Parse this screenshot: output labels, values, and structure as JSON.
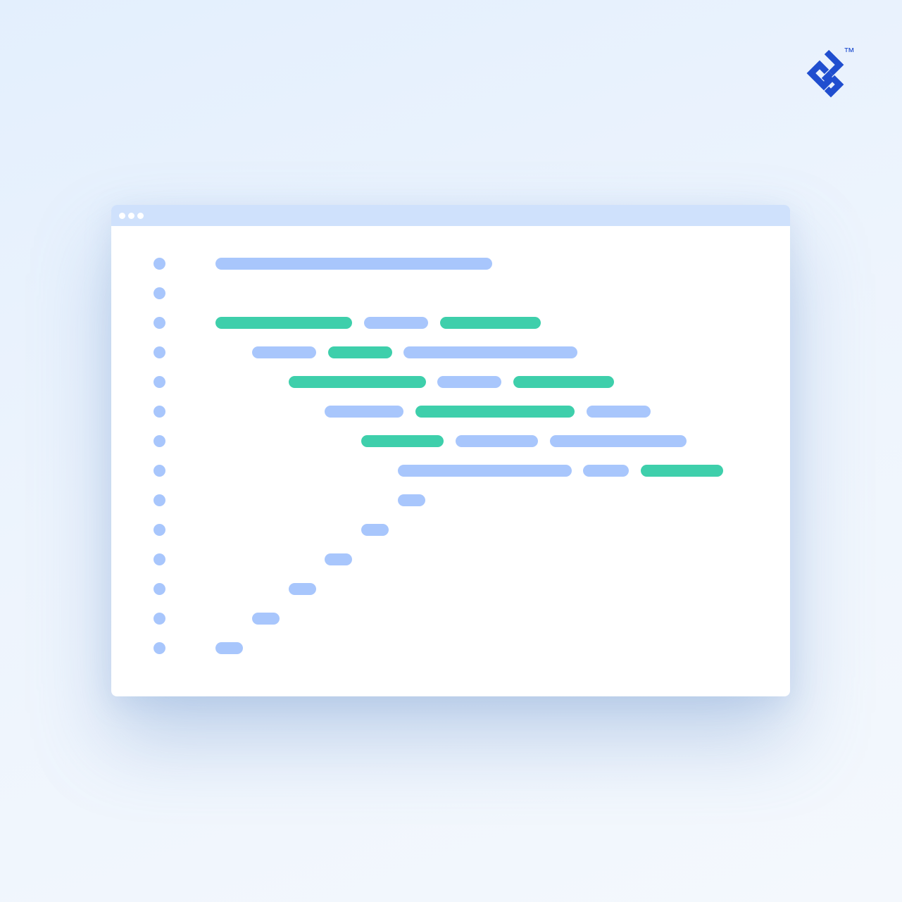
{
  "brand": {
    "logo_icon": "toptal-logo-icon",
    "trademark": "™",
    "color": "#204ecf"
  },
  "window": {
    "titlebar_color": "#cfe1fc",
    "controls": [
      "dot",
      "dot",
      "dot"
    ]
  },
  "code_colors": {
    "blue": "#a8c6fc",
    "green": "#3ecfab"
  },
  "code_lines": [
    {
      "segments": [
        "blue"
      ]
    },
    {
      "segments": []
    },
    {
      "segments": [
        "green",
        "blue",
        "green"
      ]
    },
    {
      "segments": [
        "blue",
        "green",
        "blue"
      ]
    },
    {
      "segments": [
        "green",
        "blue",
        "green"
      ]
    },
    {
      "segments": [
        "blue",
        "green",
        "blue"
      ]
    },
    {
      "segments": [
        "green",
        "blue",
        "blue"
      ]
    },
    {
      "segments": [
        "blue",
        "blue",
        "green"
      ]
    },
    {
      "segments": [
        "blue"
      ]
    },
    {
      "segments": [
        "blue"
      ]
    },
    {
      "segments": [
        "blue"
      ]
    },
    {
      "segments": [
        "blue"
      ]
    },
    {
      "segments": [
        "blue"
      ]
    },
    {
      "segments": [
        "blue"
      ]
    }
  ]
}
